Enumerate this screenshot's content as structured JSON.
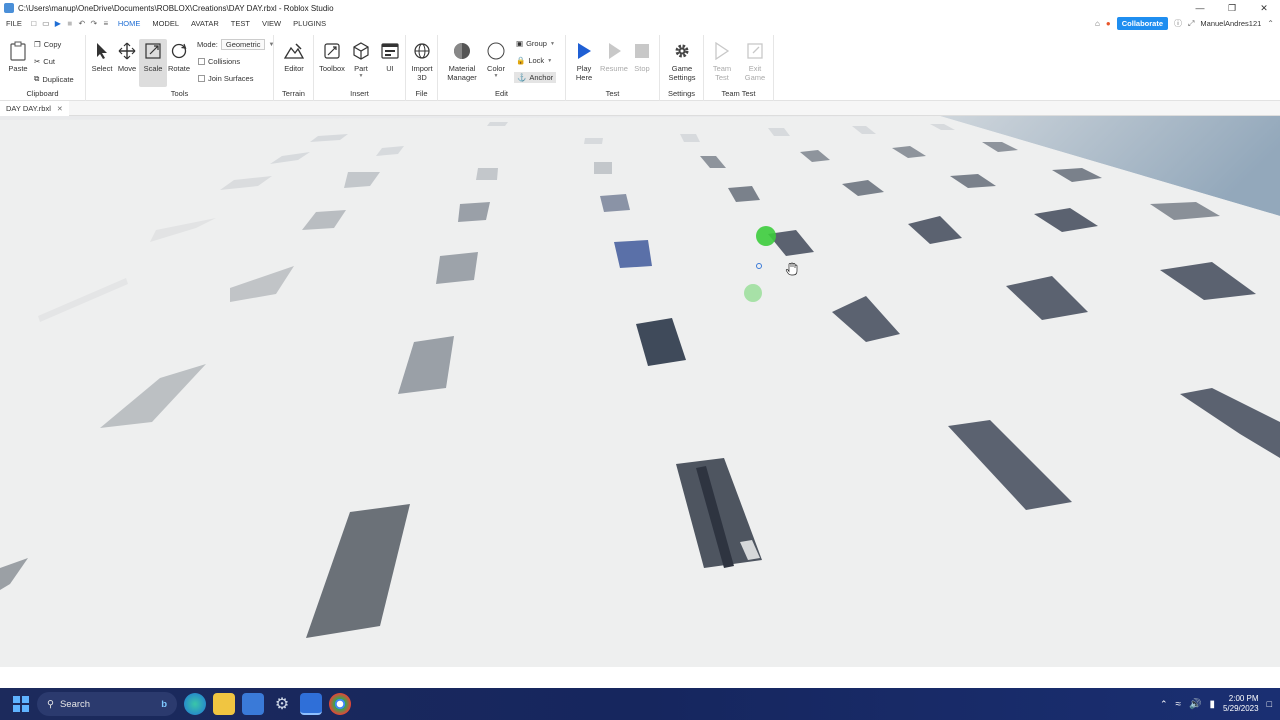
{
  "window": {
    "title": "C:\\Users\\manup\\OneDrive\\Documents\\ROBLOX\\Creations\\DAY DAY.rbxl - Roblox Studio"
  },
  "menu": {
    "items": [
      "FILE",
      "HOME",
      "MODEL",
      "AVATAR",
      "TEST",
      "VIEW",
      "PLUGINS"
    ],
    "active": "HOME",
    "collaborate": "Collaborate",
    "user": "ManuelAndres121"
  },
  "ribbon": {
    "clipboard": {
      "label": "Clipboard",
      "paste": "Paste",
      "copy": "Copy",
      "cut": "Cut",
      "duplicate": "Duplicate"
    },
    "tools": {
      "label": "Tools",
      "select": "Select",
      "move": "Move",
      "scale": "Scale",
      "rotate": "Rotate",
      "mode_label": "Mode:",
      "mode_value": "Geometric",
      "collisions": "Collisions",
      "join_surfaces": "Join Surfaces"
    },
    "terrain": {
      "label": "Terrain",
      "editor": "Editor"
    },
    "insert": {
      "label": "Insert",
      "toolbox": "Toolbox",
      "part": "Part",
      "ui": "UI"
    },
    "file": {
      "label": "File",
      "import3d_line1": "Import",
      "import3d_line2": "3D"
    },
    "edit": {
      "label": "Edit",
      "material_line1": "Material",
      "material_line2": "Manager",
      "color": "Color",
      "group": "Group",
      "lock": "Lock",
      "anchor": "Anchor"
    },
    "test": {
      "label": "Test",
      "play_line1": "Play",
      "play_line2": "Here",
      "resume": "Resume",
      "stop": "Stop"
    },
    "settings": {
      "label": "Settings",
      "game_line1": "Game",
      "game_line2": "Settings"
    },
    "team_test": {
      "label": "Team Test",
      "team_line1": "Team",
      "team_line2": "Test",
      "exit_line1": "Exit",
      "exit_line2": "Game"
    }
  },
  "doc_tab": {
    "name": "DAY DAY.rbxl",
    "close": "✕"
  },
  "taskbar": {
    "search": "Search",
    "time": "2:00 PM",
    "date": "5/29/2023"
  },
  "colors": {
    "accent": "#1f6ed4",
    "collaborate": "#1f8ef0",
    "taskbar": "#16265e",
    "baseplate": "#eeefef",
    "tile_dark": "#4a5260",
    "tile_light": "#b8bcc0",
    "tile_blue": "#5a70a8",
    "handle_green": "#3ccc3c"
  }
}
